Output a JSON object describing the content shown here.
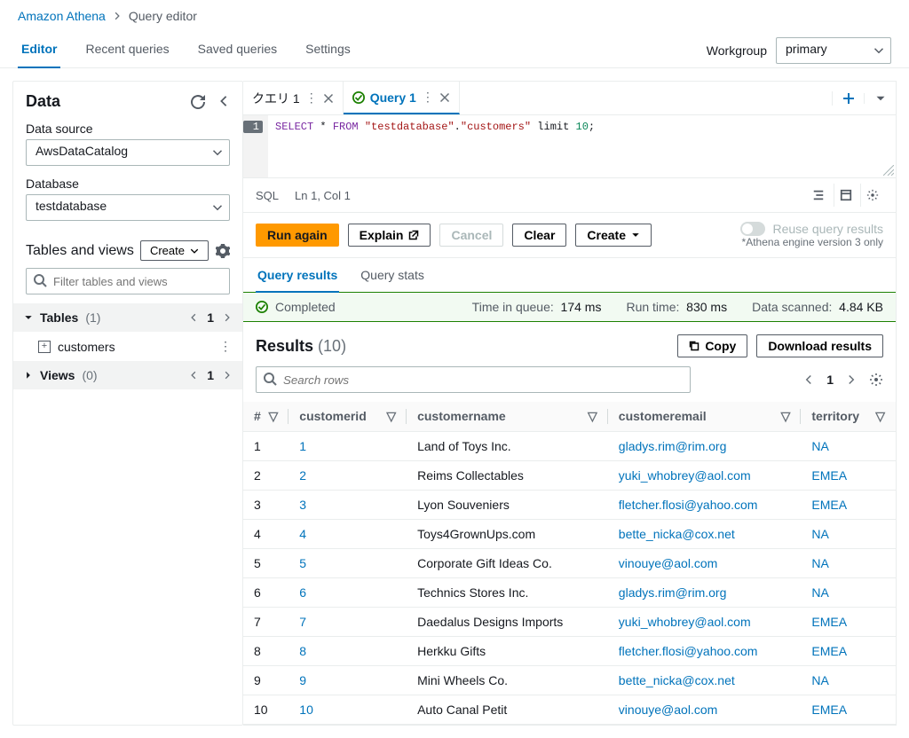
{
  "breadcrumb": {
    "service": "Amazon Athena",
    "page": "Query editor"
  },
  "nav": {
    "editor": "Editor",
    "recent": "Recent queries",
    "saved": "Saved queries",
    "settings": "Settings"
  },
  "workgroup": {
    "label": "Workgroup",
    "value": "primary"
  },
  "sidebar": {
    "title": "Data",
    "datasource_label": "Data source",
    "datasource_value": "AwsDataCatalog",
    "database_label": "Database",
    "database_value": "testdatabase",
    "tv_title": "Tables and views",
    "create_btn": "Create",
    "filter_placeholder": "Filter tables and views",
    "tables_label": "Tables",
    "tables_count": "(1)",
    "table_item": "customers",
    "views_label": "Views",
    "views_count": "(0)",
    "page_num": "1"
  },
  "query_tabs": {
    "tab1": "クエリ 1",
    "tab2": "Query 1"
  },
  "code": {
    "select": "SELECT",
    "star": " * ",
    "from": "FROM",
    "s1": " \"testdatabase\"",
    "dot": ".",
    "s2": "\"customers\"",
    "lim": " limit ",
    "n": "10",
    "semi": ";"
  },
  "statusbar": {
    "lang": "SQL",
    "pos": "Ln 1, Col 1"
  },
  "actions": {
    "run": "Run again",
    "explain": "Explain",
    "cancel": "Cancel",
    "clear": "Clear",
    "create": "Create"
  },
  "reuse": {
    "label": "Reuse query results",
    "note": "*Athena engine version 3 only"
  },
  "res_tabs": {
    "results": "Query results",
    "stats": "Query stats"
  },
  "completed": {
    "label": "Completed",
    "queue_l": "Time in queue:",
    "queue_v": "174 ms",
    "run_l": "Run time:",
    "run_v": "830 ms",
    "scan_l": "Data scanned:",
    "scan_v": "4.84 KB"
  },
  "results_header": {
    "title": "Results",
    "count": "(10)",
    "copy": "Copy",
    "download": "Download results",
    "search_placeholder": "Search rows",
    "page": "1"
  },
  "columns": {
    "idx": "#",
    "c1": "customerid",
    "c2": "customername",
    "c3": "customeremail",
    "c4": "territory"
  },
  "rows": [
    {
      "i": "1",
      "id": "1",
      "name": "Land of Toys Inc.",
      "email": "gladys.rim@rim.org",
      "terr": "NA"
    },
    {
      "i": "2",
      "id": "2",
      "name": "Reims Collectables",
      "email": "yuki_whobrey@aol.com",
      "terr": "EMEA"
    },
    {
      "i": "3",
      "id": "3",
      "name": "Lyon Souveniers",
      "email": "fletcher.flosi@yahoo.com",
      "terr": "EMEA"
    },
    {
      "i": "4",
      "id": "4",
      "name": "Toys4GrownUps.com",
      "email": "bette_nicka@cox.net",
      "terr": "NA"
    },
    {
      "i": "5",
      "id": "5",
      "name": "Corporate Gift Ideas Co.",
      "email": "vinouye@aol.com",
      "terr": "NA"
    },
    {
      "i": "6",
      "id": "6",
      "name": "Technics Stores Inc.",
      "email": "gladys.rim@rim.org",
      "terr": "NA"
    },
    {
      "i": "7",
      "id": "7",
      "name": "Daedalus Designs Imports",
      "email": "yuki_whobrey@aol.com",
      "terr": "EMEA"
    },
    {
      "i": "8",
      "id": "8",
      "name": "Herkku Gifts",
      "email": "fletcher.flosi@yahoo.com",
      "terr": "EMEA"
    },
    {
      "i": "9",
      "id": "9",
      "name": "Mini Wheels Co.",
      "email": "bette_nicka@cox.net",
      "terr": "NA"
    },
    {
      "i": "10",
      "id": "10",
      "name": "Auto Canal Petit",
      "email": "vinouye@aol.com",
      "terr": "EMEA"
    }
  ]
}
